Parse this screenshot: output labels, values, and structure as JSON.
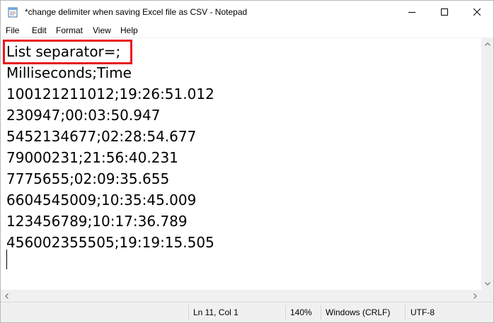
{
  "window": {
    "title": "*change delimiter when saving Excel file as CSV - Notepad",
    "app_icon": "notepad-icon",
    "controls": {
      "minimize_icon": "minimize-icon",
      "maximize_icon": "maximize-icon",
      "close_icon": "close-icon"
    }
  },
  "menu": {
    "items": [
      "File",
      "Edit",
      "Format",
      "View",
      "Help"
    ]
  },
  "editor": {
    "lines": [
      "List separator=;",
      "Milliseconds;Time",
      "100121211012;19:26:51.012",
      "230947;00:03:50.947",
      "5452134677;02:28:54.677",
      "79000231;21:56:40.231",
      "7775655;02:09:35.655",
      "6604545009;10:35:45.009",
      "123456789;10:17:36.789",
      "456002355505;19:19:15.505",
      ""
    ],
    "highlight_color": "#e8171f"
  },
  "status": {
    "position": "Ln 11, Col 1",
    "zoom": "140%",
    "line_ending": "Windows (CRLF)",
    "encoding": "UTF-8"
  }
}
